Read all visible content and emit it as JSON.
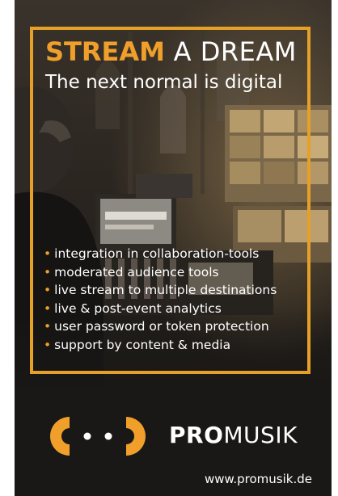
{
  "ad": {
    "headline": {
      "stream": "STREAM",
      "rest": " A DREAM"
    },
    "subhead": "The next normal is digital",
    "bullet_char": "•",
    "features": [
      "integration in collaboration-tools",
      "moderated audience tools",
      "live stream to multiple destinations",
      "live & post-event analytics",
      "user password or token protection",
      "support by content & media"
    ],
    "brand": {
      "bold": "PRO",
      "light": "MUSIK"
    },
    "url": "www.promusik.de",
    "colors": {
      "accent": "#f0a02a",
      "frame": "#e6a028",
      "background": "#1a1816",
      "text": "#ffffff"
    }
  }
}
